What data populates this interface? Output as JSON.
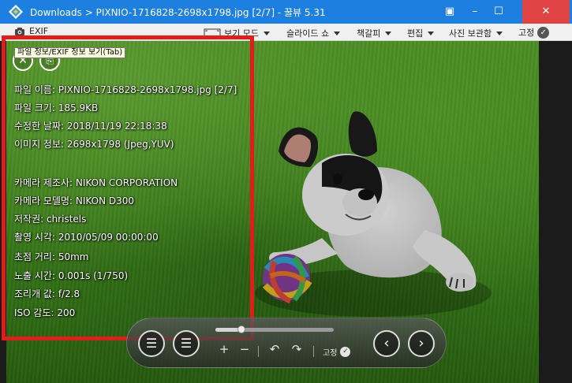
{
  "window": {
    "title": "Downloads  >  PIXNIO-1716828-2698x1798.jpg [2/7] - 꿀뷰 5.31",
    "pin_icon": "▣",
    "min_icon": "–",
    "max_icon": "☐",
    "close_icon": "✕"
  },
  "toolbar": {
    "exif_label": "EXIF",
    "items": [
      {
        "label": "보기 모드"
      },
      {
        "label": "슬라이드 쇼"
      },
      {
        "label": "책갈피"
      },
      {
        "label": "편집"
      },
      {
        "label": "사진 보관함"
      },
      {
        "label": "고정"
      }
    ]
  },
  "exif": {
    "tooltip": "파일 정보/EXIF 정보 보기(Tab)",
    "close_glyph": "✕",
    "copy_glyph": "⎘",
    "lines": [
      "파일 이름: PIXNIO-1716828-2698x1798.jpg [2/7]",
      "파일 크기: 185.9KB",
      "수정한 날짜: 2018/11/19 22:18:38",
      "이미지 정보: 2698x1798 (Jpeg,YUV)",
      "카메라 제조사: NIKON CORPORATION",
      "카메라 모델명: NIKON D300",
      "저작권: christels",
      "촬영 시각: 2010/05/09 00:00:00",
      "초점 거리: 50mm",
      "노출 시간: 0.001s (1/750)",
      "조리개 값: f/2.8",
      "ISO 감도: 200"
    ]
  },
  "controls": {
    "menu_glyph": "☰",
    "zoom_in": "+",
    "zoom_out": "−",
    "rotate_left": "↶",
    "rotate_right": "↷",
    "pin_label": "고정",
    "check_glyph": "✓",
    "prev_glyph": "‹",
    "next_glyph": "›",
    "slider_position": 0.22
  },
  "colors": {
    "titlebar": "#1d7fe0",
    "close_button": "#e04343",
    "highlight_box": "#e31b1b"
  }
}
